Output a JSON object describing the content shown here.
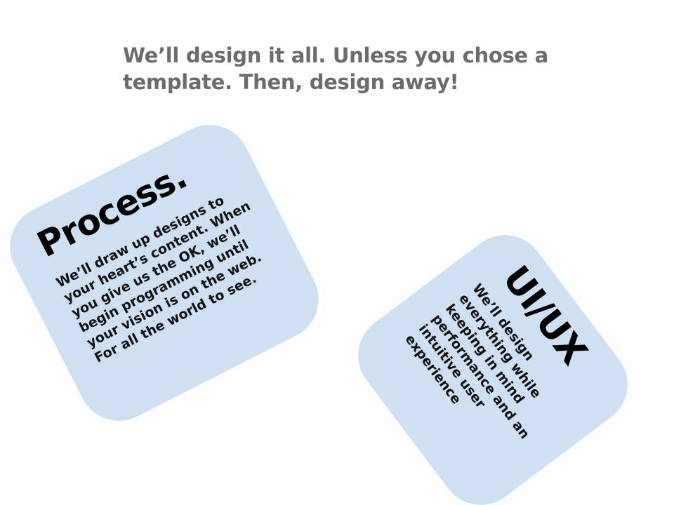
{
  "headline": "We’ll design it all. Unless you chose a template. Then, design away!",
  "cards": {
    "process": {
      "title": "Process.",
      "body": "We’ll draw up designs to your heart’s content. When you give us the OK, we’ll begin programming until your vision is on the web. For all the world to see."
    },
    "uiux": {
      "title": "UI/UX",
      "body": "We’ll design everything while keeping in mind performance and an intuitive user experience"
    }
  },
  "colors": {
    "card_background": "#cfe0f3",
    "headline_text": "#6b6b6b",
    "card_text": "#000000"
  }
}
